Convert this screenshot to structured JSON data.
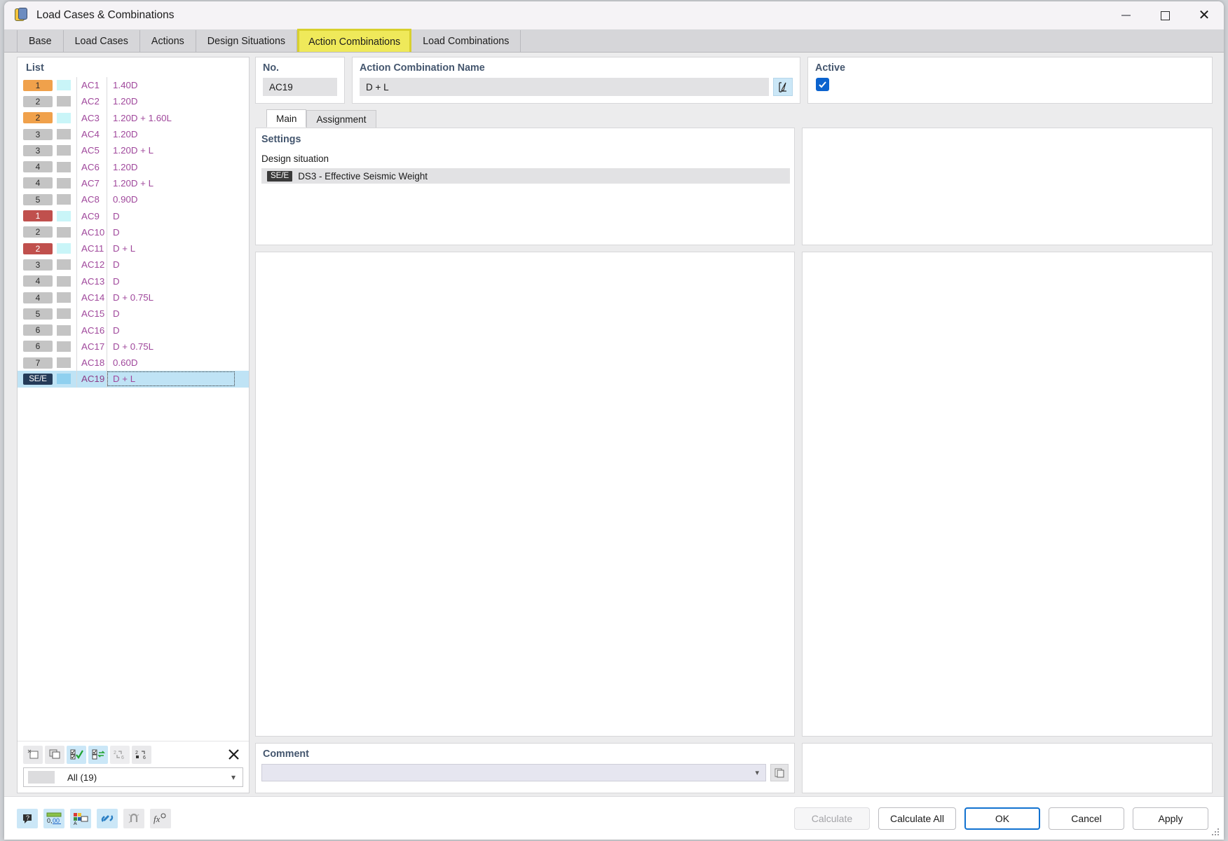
{
  "window": {
    "title": "Load Cases & Combinations",
    "icon": "load-cases-icon",
    "minimize": "minimize-icon",
    "maximize": "maximize-icon",
    "close": "close-icon"
  },
  "tabs": [
    {
      "label": "Base",
      "active": false
    },
    {
      "label": "Load Cases",
      "active": false
    },
    {
      "label": "Actions",
      "active": false
    },
    {
      "label": "Design Situations",
      "active": false
    },
    {
      "label": "Action Combinations",
      "active": true
    },
    {
      "label": "Load Combinations",
      "active": false
    }
  ],
  "list": {
    "title": "List",
    "rows": [
      {
        "badge": "1",
        "badge_color": "orange",
        "swatch": "cyan",
        "no": "AC1",
        "expression": "1.40D"
      },
      {
        "badge": "2",
        "badge_color": "gray",
        "swatch": "gray",
        "no": "AC2",
        "expression": "1.20D"
      },
      {
        "badge": "2",
        "badge_color": "orange",
        "swatch": "cyan",
        "no": "AC3",
        "expression": "1.20D + 1.60L"
      },
      {
        "badge": "3",
        "badge_color": "gray",
        "swatch": "gray",
        "no": "AC4",
        "expression": "1.20D"
      },
      {
        "badge": "3",
        "badge_color": "gray",
        "swatch": "gray",
        "no": "AC5",
        "expression": "1.20D + L"
      },
      {
        "badge": "4",
        "badge_color": "gray",
        "swatch": "gray",
        "no": "AC6",
        "expression": "1.20D"
      },
      {
        "badge": "4",
        "badge_color": "gray",
        "swatch": "gray",
        "no": "AC7",
        "expression": "1.20D + L"
      },
      {
        "badge": "5",
        "badge_color": "gray",
        "swatch": "gray",
        "no": "AC8",
        "expression": "0.90D"
      },
      {
        "badge": "1",
        "badge_color": "red",
        "swatch": "cyan",
        "no": "AC9",
        "expression": "D"
      },
      {
        "badge": "2",
        "badge_color": "gray",
        "swatch": "gray",
        "no": "AC10",
        "expression": "D"
      },
      {
        "badge": "2",
        "badge_color": "red",
        "swatch": "cyan",
        "no": "AC11",
        "expression": "D + L"
      },
      {
        "badge": "3",
        "badge_color": "gray",
        "swatch": "gray",
        "no": "AC12",
        "expression": "D"
      },
      {
        "badge": "4",
        "badge_color": "gray",
        "swatch": "gray",
        "no": "AC13",
        "expression": "D"
      },
      {
        "badge": "4",
        "badge_color": "gray",
        "swatch": "gray",
        "no": "AC14",
        "expression": "D + 0.75L"
      },
      {
        "badge": "5",
        "badge_color": "gray",
        "swatch": "gray",
        "no": "AC15",
        "expression": "D"
      },
      {
        "badge": "6",
        "badge_color": "gray",
        "swatch": "gray",
        "no": "AC16",
        "expression": "D"
      },
      {
        "badge": "6",
        "badge_color": "gray",
        "swatch": "gray",
        "no": "AC17",
        "expression": "D + 0.75L"
      },
      {
        "badge": "7",
        "badge_color": "gray",
        "swatch": "gray",
        "no": "AC18",
        "expression": "0.60D"
      },
      {
        "badge": "SE/E",
        "badge_color": "navy",
        "swatch": "blue",
        "no": "AC19",
        "expression": "D + L",
        "selected": true
      }
    ],
    "tools": [
      {
        "name": "new-item-button",
        "state": "enabled"
      },
      {
        "name": "duplicate-item-button",
        "state": "enabled"
      },
      {
        "name": "select-all-button",
        "state": "highlighted"
      },
      {
        "name": "invert-selection-button",
        "state": "highlighted"
      },
      {
        "name": "renumber-button",
        "state": "disabled"
      },
      {
        "name": "set-number-button",
        "state": "enabled"
      },
      {
        "name": "delete-button",
        "state": "enabled"
      }
    ],
    "filter": {
      "label": "All (19)",
      "chevron": "chevron-down-icon"
    }
  },
  "detail": {
    "no": {
      "label": "No.",
      "value": "AC19"
    },
    "name": {
      "label": "Action Combination Name",
      "value": "D + L",
      "edit_icon": "edit-pencil-icon"
    },
    "active": {
      "label": "Active",
      "checked": true
    },
    "inner_tabs": [
      {
        "label": "Main",
        "active": true
      },
      {
        "label": "Assignment",
        "active": false
      }
    ],
    "settings": {
      "title": "Settings",
      "design_situation_label": "Design situation",
      "design_situation_badge": "SE/E",
      "design_situation_value": "DS3 - Effective Seismic Weight"
    },
    "comment": {
      "label": "Comment",
      "value": "",
      "chevron": "chevron-down-icon",
      "icon": "copy-icon"
    }
  },
  "footer": {
    "tools": [
      {
        "name": "help-icon",
        "state": "enabled"
      },
      {
        "name": "units-icon",
        "state": "enabled"
      },
      {
        "name": "colors-icon",
        "state": "enabled"
      },
      {
        "name": "link-icon",
        "state": "enabled"
      },
      {
        "name": "snap-icon",
        "state": "disabled"
      },
      {
        "name": "formula-icon",
        "state": "disabled"
      }
    ],
    "buttons": [
      {
        "label": "Calculate",
        "style": "disabled"
      },
      {
        "label": "Calculate All",
        "style": "normal"
      },
      {
        "label": "OK",
        "style": "primary"
      },
      {
        "label": "Cancel",
        "style": "normal"
      },
      {
        "label": "Apply",
        "style": "normal"
      }
    ]
  },
  "colors": {
    "accent": "#0b63ce",
    "tab_highlight": "#efe95a",
    "expression_text": "#a0489c",
    "selection": "#bfe3f5",
    "label_blue": "#44566e"
  }
}
